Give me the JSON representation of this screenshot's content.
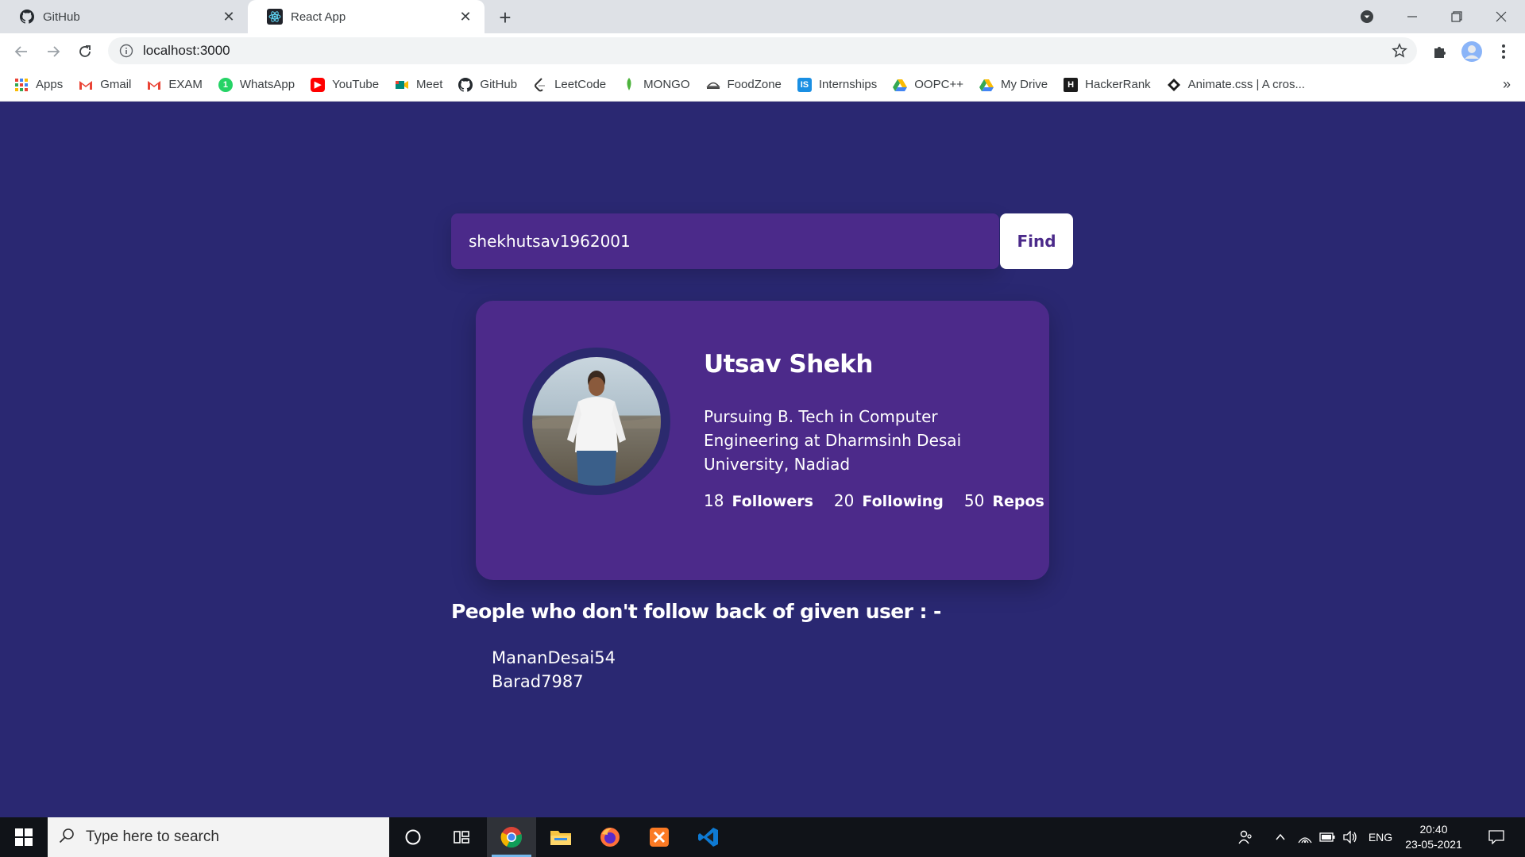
{
  "browser": {
    "tabs": [
      {
        "title": "GitHub",
        "icon": "github-icon",
        "active": false
      },
      {
        "title": "React App",
        "icon": "react-icon",
        "active": true
      }
    ],
    "address": "localhost:3000",
    "bookmarks": [
      {
        "label": "Apps",
        "icon": "apps-grid-icon",
        "color": "#ea4335"
      },
      {
        "label": "Gmail",
        "icon": "gmail-icon",
        "color": "#ea4335"
      },
      {
        "label": "EXAM",
        "icon": "gmail-icon",
        "color": "#ea4335"
      },
      {
        "label": "WhatsApp",
        "icon": "whatsapp-icon",
        "color": "#25d366"
      },
      {
        "label": "YouTube",
        "icon": "youtube-icon",
        "color": "#ff0000"
      },
      {
        "label": "Meet",
        "icon": "meet-icon",
        "color": "#00897b"
      },
      {
        "label": "GitHub",
        "icon": "github-icon",
        "color": "#24292e"
      },
      {
        "label": "LeetCode",
        "icon": "leetcode-icon",
        "color": "#ffa116"
      },
      {
        "label": "MONGO",
        "icon": "mongodb-leaf-icon",
        "color": "#4db33d"
      },
      {
        "label": "FoodZone",
        "icon": "food-icon",
        "color": "#555555"
      },
      {
        "label": "Internships",
        "icon": "internshala-icon",
        "color": "#1a8fe3"
      },
      {
        "label": "OOPC++",
        "icon": "google-drive-icon",
        "color": "#fbbc04"
      },
      {
        "label": "My Drive",
        "icon": "google-drive-icon",
        "color": "#fbbc04"
      },
      {
        "label": "HackerRank",
        "icon": "hackerrank-icon",
        "color": "#1b1b1b"
      },
      {
        "label": "Animate.css | A cros...",
        "icon": "animate-css-icon",
        "color": "#1b1b1b"
      }
    ]
  },
  "search": {
    "value": "shekhutsav1962001",
    "button_label": "Find"
  },
  "profile": {
    "name": "Utsav Shekh",
    "bio": "Pursuing B. Tech in Computer Engineering at Dharmsinh Desai University, Nadiad",
    "followers_count": "18",
    "followers_label": "Followers",
    "following_count": "20",
    "following_label": "Following",
    "repos_count": "50",
    "repos_label": "Repos"
  },
  "non_followers": {
    "heading": "People who don't follow back of given user : -",
    "users": [
      "MananDesai54",
      "Barad7987"
    ]
  },
  "taskbar": {
    "search_placeholder": "Type here to search",
    "language": "ENG",
    "time": "20:40",
    "date": "23-05-2021"
  },
  "colors": {
    "page_background": "#2a2872",
    "card_background": "#4c2a8a",
    "accent": "#4b2a8a"
  }
}
